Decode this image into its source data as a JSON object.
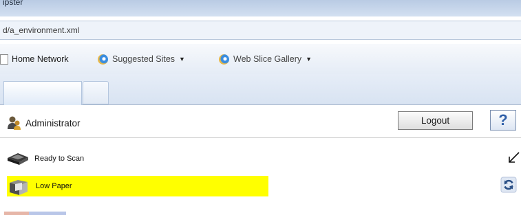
{
  "browser": {
    "title": "ipster",
    "address": "d/a_environment.xml",
    "favorites": [
      {
        "label": "Home Network"
      },
      {
        "label": "Suggested Sites",
        "has_dropdown": true
      },
      {
        "label": "Web Slice Gallery",
        "has_dropdown": true
      }
    ]
  },
  "app": {
    "user": {
      "label": "Administrator",
      "icon": "user-group-icon"
    },
    "logout_label": "Logout",
    "help_label": "?",
    "status": [
      {
        "label": "Ready to Scan",
        "icon": "scanner-icon",
        "highlight": false
      },
      {
        "label": "Low Paper",
        "icon": "printer-icon",
        "highlight": true,
        "highlight_color": "#ffff00"
      }
    ],
    "refresh_icon": "refresh-icon"
  },
  "colors": {
    "accent": "#2f5fa8",
    "warning_highlight": "#ffff00"
  }
}
